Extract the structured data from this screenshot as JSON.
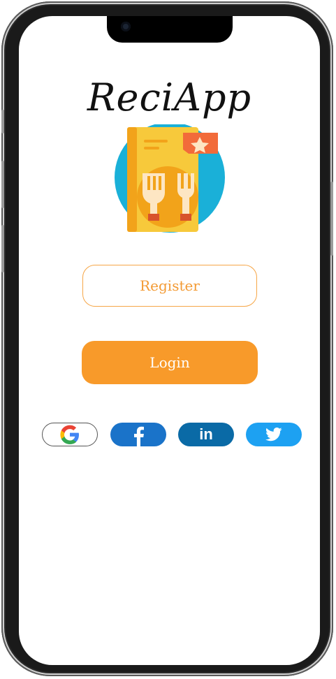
{
  "app": {
    "title": "ReciApp"
  },
  "actions": {
    "register_label": "Register",
    "login_label": "Login"
  },
  "social": [
    {
      "name": "google",
      "icon": "google-icon"
    },
    {
      "name": "facebook",
      "icon": "facebook-icon"
    },
    {
      "name": "linkedin",
      "icon": "linkedin-icon",
      "text": "in"
    },
    {
      "name": "twitter",
      "icon": "twitter-icon"
    }
  ],
  "colors": {
    "accent": "#f89a2a",
    "register_text": "#f39a33",
    "facebook": "#1a73c9",
    "linkedin": "#0a6aa6",
    "twitter": "#1da1f2"
  }
}
